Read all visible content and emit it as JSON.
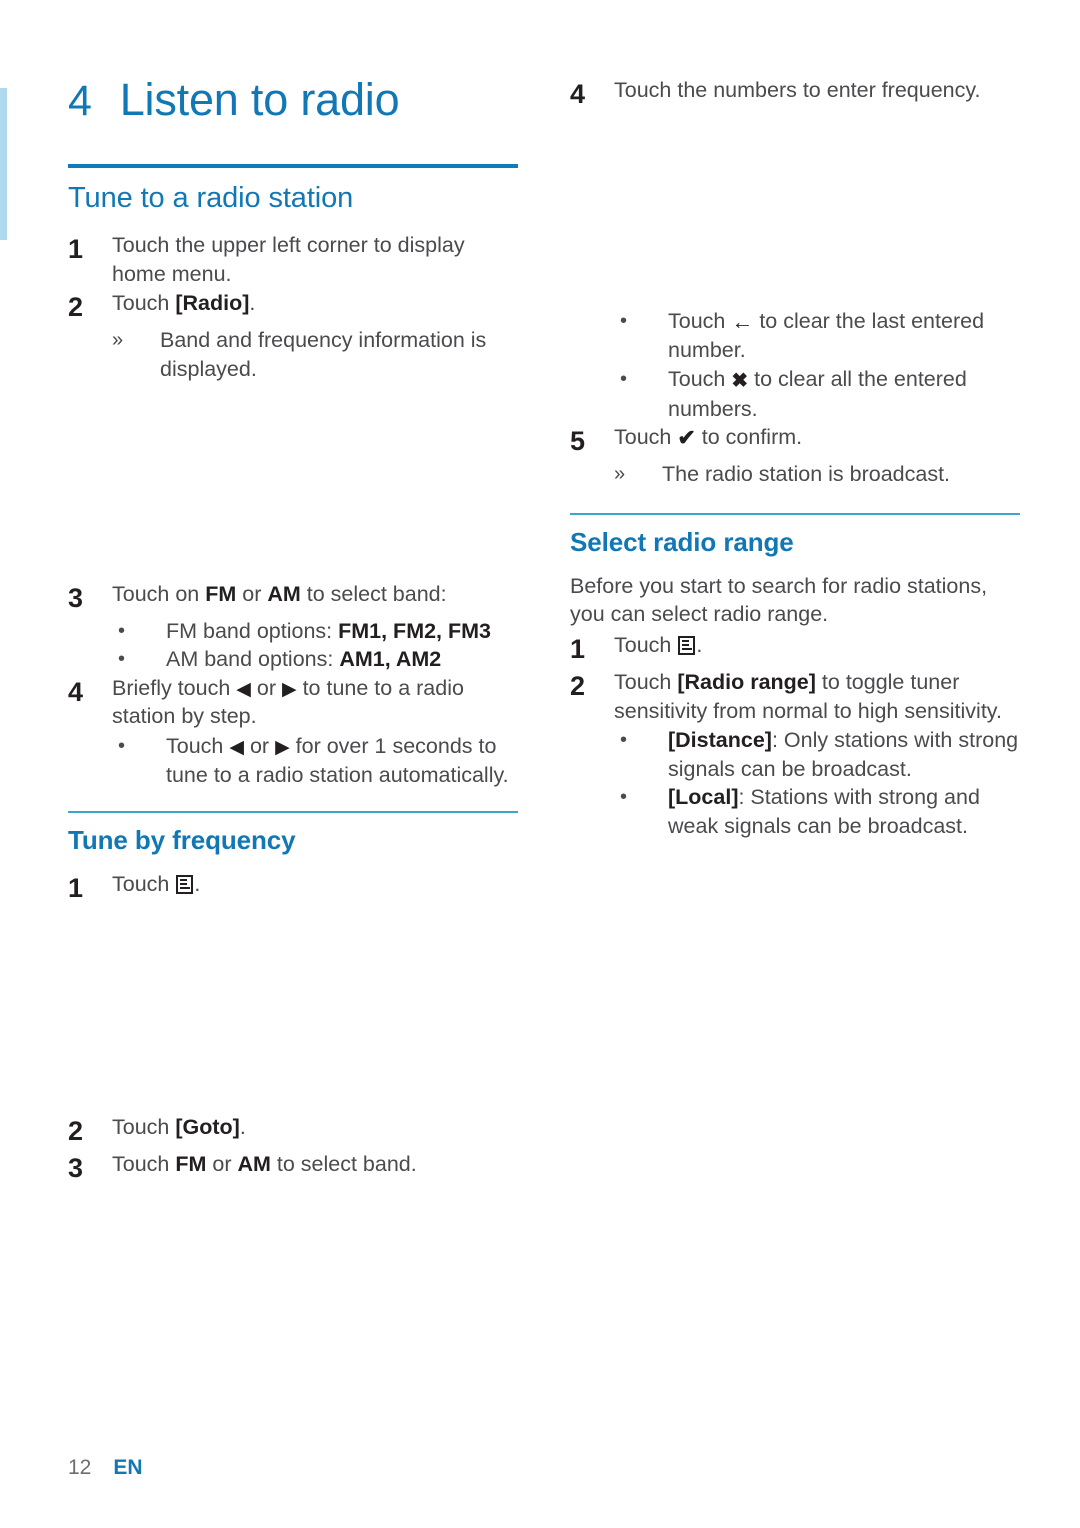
{
  "document": {
    "chapter_number": "4",
    "chapter_title": "Listen to radio",
    "page_number": "12",
    "language_code": "EN",
    "accent_color": "#1278b5",
    "rule_color": "#0f7cba",
    "edge_marker_color": "#aed9ef",
    "body_text_color": "#4b4a4d"
  },
  "left_column": {
    "section1": {
      "heading": "Tune to a radio station",
      "steps": [
        {
          "num": "1",
          "text": "Touch the upper left corner to display home menu."
        },
        {
          "num": "2",
          "text_prefix": "Touch ",
          "text_bold": "[Radio]",
          "text_suffix": ".",
          "result_mark": "»",
          "result": "Band and frequency information is displayed."
        },
        {
          "num": "3",
          "text_a": "Touch on ",
          "bold_a": "FM",
          "text_b": " or ",
          "bold_b": "AM",
          "text_c": " to select band:",
          "bullets": [
            {
              "mark": "•",
              "plain": "FM band options: ",
              "bold": "FM1, FM2, FM3"
            },
            {
              "mark": "•",
              "plain": "AM band options: ",
              "bold": "AM1, AM2"
            }
          ]
        },
        {
          "num": "4",
          "text_a": "Briefly touch ",
          "icon_a": "◀",
          "text_b": " or ",
          "icon_b": "▶",
          "text_c": " to tune to a radio station by step.",
          "bullets": [
            {
              "mark": "•",
              "text_a": "Touch ",
              "icon_a": "◀",
              "text_b": " or ",
              "icon_b": "▶",
              "text_c": " for over 1 seconds to tune to a radio station automatically."
            }
          ]
        }
      ]
    },
    "section2": {
      "heading": "Tune by frequency",
      "steps": [
        {
          "num": "1",
          "text_prefix": "Touch ",
          "icon": "menu-icon",
          "text_suffix": "."
        },
        {
          "num": "2",
          "text_prefix": "Touch ",
          "text_bold": "[Goto]",
          "text_suffix": "."
        },
        {
          "num": "3",
          "text_a": "Touch ",
          "bold_a": "FM",
          "text_b": " or ",
          "bold_b": "AM",
          "text_c": " to select band."
        }
      ]
    }
  },
  "right_column": {
    "continued_steps": [
      {
        "num": "4",
        "text": "Touch the numbers to enter frequency.",
        "bullets": [
          {
            "mark": "•",
            "text_a": "Touch ",
            "icon": "←",
            "text_b": " to clear the last entered number."
          },
          {
            "mark": "•",
            "text_a": "Touch ",
            "icon": "✖",
            "text_b": " to clear all the entered numbers."
          }
        ]
      },
      {
        "num": "5",
        "text_a": "Touch ",
        "icon": "✔",
        "text_b": " to confirm.",
        "result_mark": "»",
        "result": "The radio station is broadcast."
      }
    ],
    "section3": {
      "heading": "Select radio range",
      "intro": "Before you start to search for radio stations, you can select radio range.",
      "steps": [
        {
          "num": "1",
          "text_prefix": "Touch ",
          "icon": "menu-icon",
          "text_suffix": "."
        },
        {
          "num": "2",
          "text_prefix": "Touch ",
          "text_bold": "[Radio range]",
          "text_suffix": " to toggle tuner sensitivity from normal to high sensitivity.",
          "bullets": [
            {
              "mark": "•",
              "bold": "[Distance]",
              "plain": ": Only stations with strong signals can be broadcast."
            },
            {
              "mark": "•",
              "bold": "[Local]",
              "plain": ": Stations with strong and weak signals can be broadcast."
            }
          ]
        }
      ]
    }
  }
}
